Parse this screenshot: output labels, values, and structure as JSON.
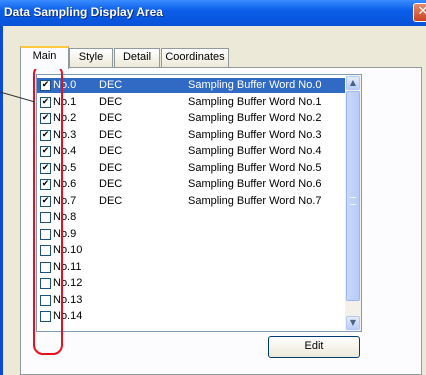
{
  "window": {
    "title": "Data Sampling Display Area",
    "close_label": "✕"
  },
  "tabs": [
    {
      "label": "Main",
      "active": true
    },
    {
      "label": "Style",
      "active": false
    },
    {
      "label": "Detail",
      "active": false
    },
    {
      "label": "Coordinates",
      "active": false
    }
  ],
  "list": {
    "selected_index": 0,
    "rows": [
      {
        "no": "No.0",
        "format": "DEC",
        "desc": "Sampling Buffer Word No.0",
        "checked": true
      },
      {
        "no": "No.1",
        "format": "DEC",
        "desc": "Sampling Buffer Word No.1",
        "checked": true
      },
      {
        "no": "No.2",
        "format": "DEC",
        "desc": "Sampling Buffer Word No.2",
        "checked": true
      },
      {
        "no": "No.3",
        "format": "DEC",
        "desc": "Sampling Buffer Word No.3",
        "checked": true
      },
      {
        "no": "No.4",
        "format": "DEC",
        "desc": "Sampling Buffer Word No.4",
        "checked": true
      },
      {
        "no": "No.5",
        "format": "DEC",
        "desc": "Sampling Buffer Word No.5",
        "checked": true
      },
      {
        "no": "No.6",
        "format": "DEC",
        "desc": "Sampling Buffer Word No.6",
        "checked": true
      },
      {
        "no": "No.7",
        "format": "DEC",
        "desc": "Sampling Buffer Word No.7",
        "checked": true
      },
      {
        "no": "No.8",
        "format": "",
        "desc": "",
        "checked": false
      },
      {
        "no": "No.9",
        "format": "",
        "desc": "",
        "checked": false
      },
      {
        "no": "No.10",
        "format": "",
        "desc": "",
        "checked": false
      },
      {
        "no": "No.11",
        "format": "",
        "desc": "",
        "checked": false
      },
      {
        "no": "No.12",
        "format": "",
        "desc": "",
        "checked": false
      },
      {
        "no": "No.13",
        "format": "",
        "desc": "",
        "checked": false
      },
      {
        "no": "No.14",
        "format": "",
        "desc": "",
        "checked": false
      }
    ]
  },
  "scrollbar": {
    "up_icon": "chevron-up-icon",
    "down_icon": "chevron-down-icon"
  },
  "buttons": {
    "edit_label": "Edit"
  },
  "colors": {
    "titlebar": "#0b5ee9",
    "selection": "#316ac5",
    "highlight": "#e8101e",
    "tab_accent": "#ffc83c"
  }
}
